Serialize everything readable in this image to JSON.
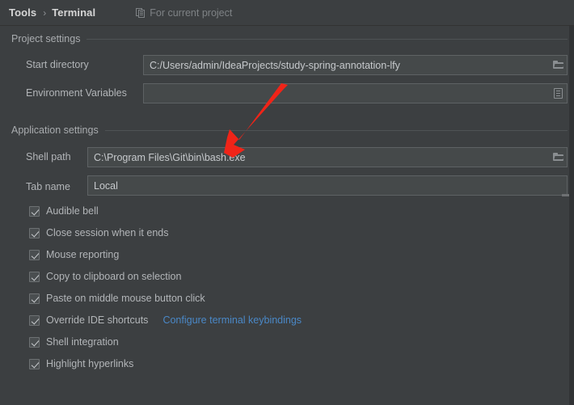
{
  "header": {
    "breadcrumb_root": "Tools",
    "breadcrumb_separator": "›",
    "breadcrumb_leaf": "Terminal",
    "scope_label": "For current project",
    "scope_icon": "copy-project-icon"
  },
  "sections": {
    "project": {
      "title": "Project settings",
      "fields": [
        {
          "label": "Start directory",
          "value": "C:/Users/admin/IdeaProjects/study-spring-annotation-lfy",
          "button_icon": "folder-open-icon"
        },
        {
          "label": "Environment Variables",
          "value": "",
          "button_icon": "variables-list-icon"
        }
      ]
    },
    "application": {
      "title": "Application settings",
      "fields": [
        {
          "label": "Shell path",
          "value": "C:\\Program Files\\Git\\bin\\bash.exe",
          "button_icon": "folder-open-icon"
        },
        {
          "label": "Tab name",
          "value": "Local",
          "button_icon": ""
        }
      ],
      "checkboxes": [
        {
          "label": "Audible bell",
          "checked": true
        },
        {
          "label": "Close session when it ends",
          "checked": true
        },
        {
          "label": "Mouse reporting",
          "checked": true
        },
        {
          "label": "Copy to clipboard on selection",
          "checked": true
        },
        {
          "label": "Paste on middle mouse button click",
          "checked": true
        },
        {
          "label": "Override IDE shortcuts",
          "checked": true
        },
        {
          "label": "Shell integration",
          "checked": true
        },
        {
          "label": "Highlight hyperlinks",
          "checked": true
        }
      ],
      "keybindings_link": "Configure terminal keybindings"
    }
  },
  "annotation": {
    "type": "arrow",
    "color": "#f02418",
    "points_at": "Shell path value"
  },
  "colors": {
    "background": "#3c3f41",
    "field_background": "#45494a",
    "field_border": "#5e6264",
    "text": "#b2b5b8",
    "link": "#4a88c7",
    "annotation_red": "#f02418"
  }
}
